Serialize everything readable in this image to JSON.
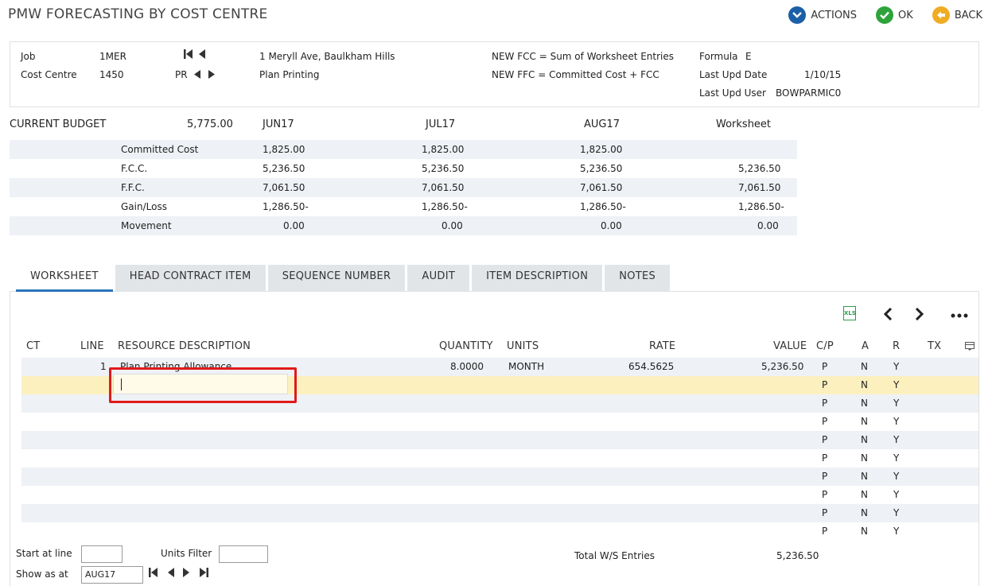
{
  "title": "PMW FORECASTING BY COST CENTRE",
  "actions": {
    "actions_label": "ACTIONS",
    "ok_label": "OK",
    "back_label": "BACK"
  },
  "header": {
    "job_label": "Job",
    "job_value": "1MER",
    "cost_centre_label": "Cost Centre",
    "cost_centre_value": "1450",
    "cost_centre_code": "PR",
    "address": "1 Meryll Ave, Baulkham Hills",
    "cc_description": "Plan Printing",
    "fcc_formula": "NEW FCC = Sum of Worksheet Entries",
    "ffc_formula": "NEW FFC = Committed Cost + FCC",
    "formula_label": "Formula",
    "formula_value": "E",
    "last_upd_date_label": "Last Upd Date",
    "last_upd_date_value": "1/10/15",
    "last_upd_user_label": "Last Upd User",
    "last_upd_user_value": "BOWPARMIC0"
  },
  "budget": {
    "label": "CURRENT BUDGET",
    "value": "5,775.00",
    "columns": [
      "JUN17",
      "JUL17",
      "AUG17",
      "Worksheet"
    ],
    "rows": [
      {
        "label": "Committed Cost",
        "values": [
          "1,825.00",
          "1,825.00",
          "1,825.00",
          ""
        ]
      },
      {
        "label": "F.C.C.",
        "values": [
          "5,236.50",
          "5,236.50",
          "5,236.50",
          "5,236.50"
        ]
      },
      {
        "label": "F.F.C.",
        "values": [
          "7,061.50",
          "7,061.50",
          "7,061.50",
          "7,061.50"
        ]
      },
      {
        "label": "Gain/Loss",
        "values": [
          "1,286.50-",
          "1,286.50-",
          "1,286.50-",
          "1,286.50-"
        ]
      },
      {
        "label": "Movement",
        "values": [
          "0.00",
          "0.00",
          "0.00",
          "0.00"
        ]
      }
    ]
  },
  "tabs": [
    "WORKSHEET",
    "HEAD CONTRACT ITEM",
    "SEQUENCE NUMBER",
    "AUDIT",
    "ITEM DESCRIPTION",
    "NOTES"
  ],
  "toolbar": {
    "xls_label": "XLS"
  },
  "grid": {
    "columns": {
      "ct": "CT",
      "line": "LINE",
      "desc": "RESOURCE DESCRIPTION",
      "qty": "QUANTITY",
      "units": "UNITS",
      "rate": "RATE",
      "value": "VALUE",
      "cp": "C/P",
      "a": "A",
      "r": "R",
      "tx": "TX"
    },
    "rows": [
      {
        "line": "1",
        "desc": "Plan Printing Allowance",
        "qty": "8.0000",
        "units": "MONTH",
        "rate": "654.5625",
        "value": "5,236.50",
        "cp": "P",
        "a": "N",
        "r": "Y"
      },
      {
        "line": "",
        "desc": "",
        "qty": "",
        "units": "",
        "rate": "",
        "value": "",
        "cp": "P",
        "a": "N",
        "r": "Y"
      },
      {
        "line": "",
        "desc": "",
        "qty": "",
        "units": "",
        "rate": "",
        "value": "",
        "cp": "P",
        "a": "N",
        "r": "Y"
      },
      {
        "line": "",
        "desc": "",
        "qty": "",
        "units": "",
        "rate": "",
        "value": "",
        "cp": "P",
        "a": "N",
        "r": "Y"
      },
      {
        "line": "",
        "desc": "",
        "qty": "",
        "units": "",
        "rate": "",
        "value": "",
        "cp": "P",
        "a": "N",
        "r": "Y"
      },
      {
        "line": "",
        "desc": "",
        "qty": "",
        "units": "",
        "rate": "",
        "value": "",
        "cp": "P",
        "a": "N",
        "r": "Y"
      },
      {
        "line": "",
        "desc": "",
        "qty": "",
        "units": "",
        "rate": "",
        "value": "",
        "cp": "P",
        "a": "N",
        "r": "Y"
      },
      {
        "line": "",
        "desc": "",
        "qty": "",
        "units": "",
        "rate": "",
        "value": "",
        "cp": "P",
        "a": "N",
        "r": "Y"
      },
      {
        "line": "",
        "desc": "",
        "qty": "",
        "units": "",
        "rate": "",
        "value": "",
        "cp": "P",
        "a": "N",
        "r": "Y"
      },
      {
        "line": "",
        "desc": "",
        "qty": "",
        "units": "",
        "rate": "",
        "value": "",
        "cp": "P",
        "a": "N",
        "r": "Y"
      }
    ]
  },
  "footer": {
    "start_at_line_label": "Start at line",
    "start_at_line_value": "",
    "units_filter_label": "Units Filter",
    "units_filter_value": "",
    "show_as_at_label": "Show as at",
    "show_as_at_value": "AUG17",
    "total_label": "Total W/S Entries",
    "total_value": "5,236.50"
  },
  "colors": {
    "accent_blue": "#2a73b8",
    "ok_green": "#2ea33c",
    "back_orange": "#f0ac22",
    "highlight_red": "#e01a1a",
    "selected_row": "#fcf0bf"
  }
}
